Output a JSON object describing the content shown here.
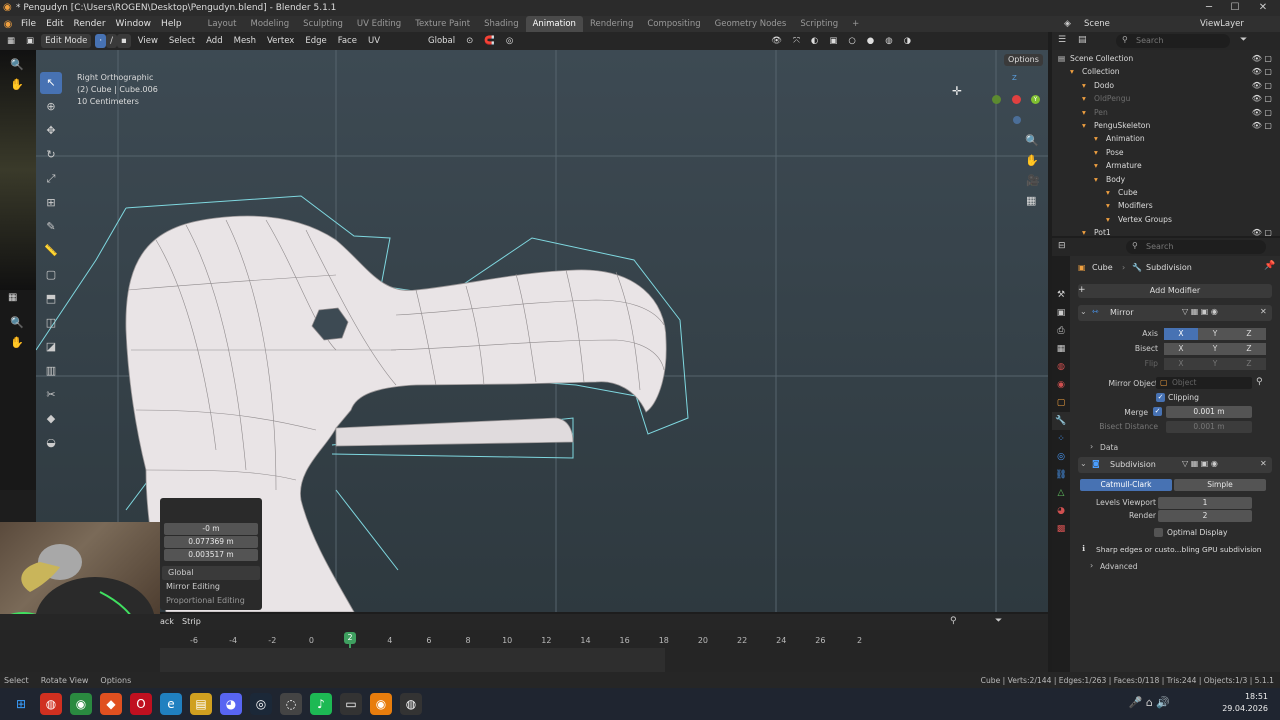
{
  "window": {
    "title": "* Pengudyn [C:\\Users\\ROGEN\\Desktop\\Pengudyn.blend] - Blender 5.1.1"
  },
  "menu": {
    "items": [
      "File",
      "Edit",
      "Render",
      "Window",
      "Help"
    ]
  },
  "workspaces": [
    "Layout",
    "Modeling",
    "Sculpting",
    "UV Editing",
    "Texture Paint",
    "Shading",
    "Animation",
    "Rendering",
    "Compositing",
    "Geometry Nodes",
    "Scripting"
  ],
  "workspace_active": "Animation",
  "scene": {
    "name": "Scene",
    "view_layer": "ViewLayer"
  },
  "viewport_header": {
    "mode": "Edit Mode",
    "menus": [
      "View",
      "Select",
      "Add",
      "Mesh",
      "Vertex",
      "Edge",
      "Face",
      "UV"
    ],
    "orientation": "Global",
    "options": "Options"
  },
  "gizmo_axes": {
    "x": "X",
    "y": "Y",
    "z": "Z"
  },
  "viewport_overlay": {
    "view": "Right Orthographic",
    "object": "(2) Cube | Cube.006",
    "scale": "10 Centimeters"
  },
  "redo_panel": {
    "values": [
      "-0 m",
      "0.077369 m",
      "0.003517 m"
    ],
    "orientation": "Global",
    "mirror_editing": "Mirror Editing",
    "proportional_editing": "Proportional Editing"
  },
  "timeline": {
    "menus": [
      "ack",
      "Strip"
    ],
    "ticks": [
      "-6",
      "-4",
      "-2",
      "0",
      "2",
      "4",
      "6",
      "8",
      "10",
      "12",
      "14",
      "16",
      "18",
      "20",
      "22",
      "24",
      "26",
      "2"
    ],
    "current_frame": "2"
  },
  "status": {
    "left": [
      "Select",
      "Rotate View",
      "Options"
    ],
    "stats": "Cube | Verts:2/144 | Edges:1/263 | Faces:0/118 | Tris:244 | Objects:1/3 | 5.1.1"
  },
  "taskbar": {
    "time": "18:51",
    "date": "29.04.2026"
  },
  "outliner": {
    "search_placeholder": "Search",
    "rows": [
      {
        "label": "Scene Collection",
        "indent": 0,
        "dim": false,
        "sel": false
      },
      {
        "label": "Collection",
        "indent": 1,
        "dim": false,
        "sel": false
      },
      {
        "label": "Dodo",
        "indent": 2,
        "dim": false,
        "sel": false
      },
      {
        "label": "OldPengu",
        "indent": 2,
        "dim": true,
        "sel": false
      },
      {
        "label": "Pen",
        "indent": 2,
        "dim": true,
        "sel": false
      },
      {
        "label": "PenguSkeleton",
        "indent": 2,
        "dim": false,
        "sel": false
      },
      {
        "label": "Animation",
        "indent": 3,
        "dim": false,
        "sel": false
      },
      {
        "label": "Pose",
        "indent": 3,
        "dim": false,
        "sel": false
      },
      {
        "label": "Armature",
        "indent": 3,
        "dim": false,
        "sel": false
      },
      {
        "label": "Body",
        "indent": 3,
        "dim": false,
        "sel": false
      },
      {
        "label": "Cube",
        "indent": 4,
        "dim": false,
        "sel": false
      },
      {
        "label": "Modifiers",
        "indent": 4,
        "dim": false,
        "sel": false
      },
      {
        "label": "Vertex Groups",
        "indent": 4,
        "dim": false,
        "sel": false
      },
      {
        "label": "Pot1",
        "indent": 2,
        "dim": false,
        "sel": false
      }
    ]
  },
  "properties": {
    "search_placeholder": "Search",
    "breadcrumb": [
      "Cube",
      "Subdivision"
    ],
    "add_modifier": "Add Modifier",
    "mirror": {
      "name": "Mirror",
      "axis_label": "Axis",
      "bisect_label": "Bisect",
      "flip_label": "Flip",
      "axes": [
        "X",
        "Y",
        "Z"
      ],
      "mirror_object_label": "Mirror Object",
      "mirror_object_placeholder": "Object",
      "clipping": "Clipping",
      "merge_label": "Merge",
      "merge_value": "0.001 m",
      "bisect_distance_label": "Bisect Distance",
      "bisect_distance_value": "0.001 m",
      "data_label": "Data"
    },
    "subdivision": {
      "name": "Subdivision",
      "method_active": "Catmull-Clark",
      "method_other": "Simple",
      "levels_viewport_label": "Levels Viewport",
      "levels_viewport": "1",
      "render_label": "Render",
      "render": "2",
      "optimal_display": "Optimal Display",
      "info": "Sharp edges or custo...bling GPU subdivision",
      "advanced": "Advanced"
    }
  },
  "colors": {
    "accent": "#4772b3",
    "cage": "#7fd8e0",
    "mesh": "#e9e4e6"
  }
}
